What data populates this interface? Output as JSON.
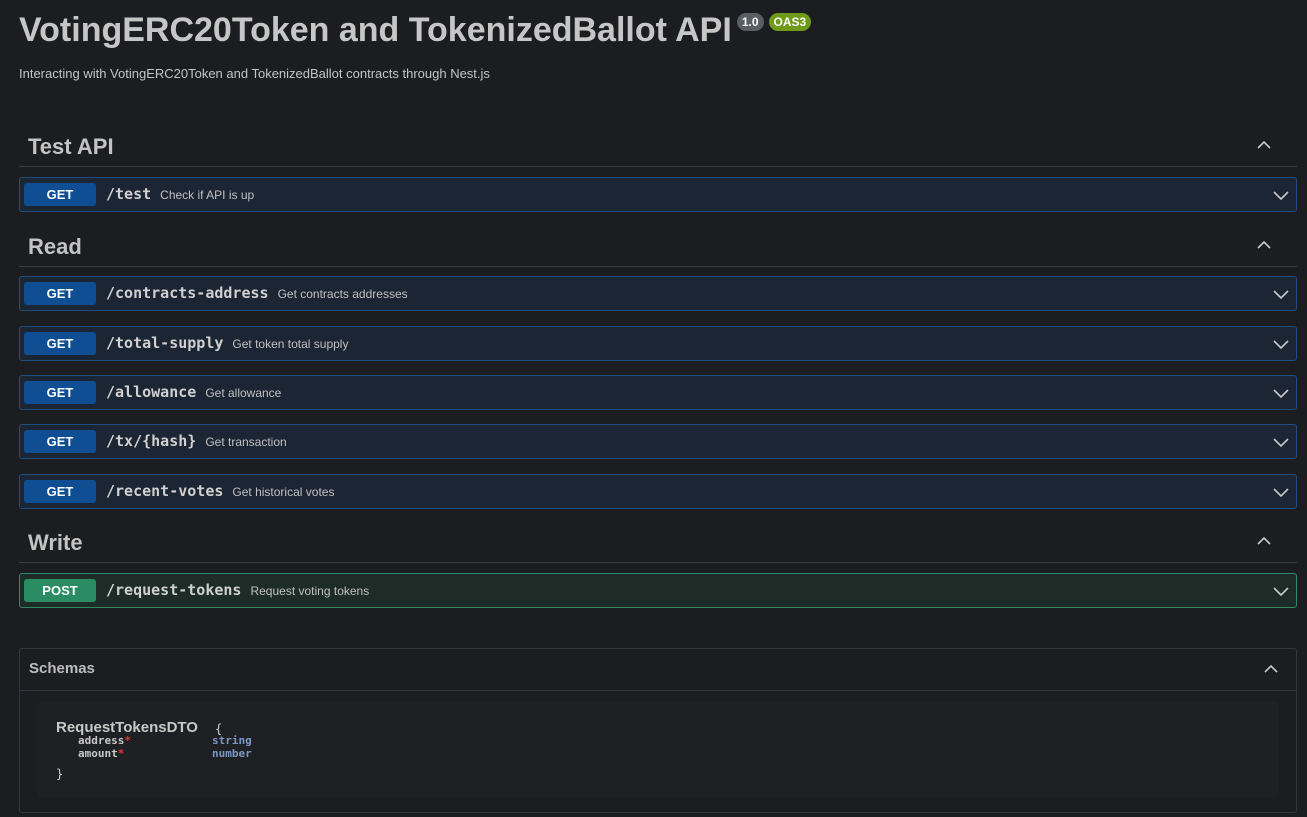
{
  "info": {
    "title": "VotingERC20Token and TokenizedBallot API",
    "version": "1.0",
    "oas": "OAS3",
    "description": "Interacting with VotingERC20Token and TokenizedBallot contracts through Nest.js"
  },
  "sections": [
    {
      "name": "Test API",
      "operations": [
        {
          "method": "GET",
          "path": "/test",
          "summary": "Check if API is up"
        }
      ]
    },
    {
      "name": "Read",
      "operations": [
        {
          "method": "GET",
          "path": "/contracts-address",
          "summary": "Get contracts addresses"
        },
        {
          "method": "GET",
          "path": "/total-supply",
          "summary": "Get token total supply"
        },
        {
          "method": "GET",
          "path": "/allowance",
          "summary": "Get allowance"
        },
        {
          "method": "GET",
          "path": "/tx/{hash}",
          "summary": "Get transaction"
        },
        {
          "method": "GET",
          "path": "/recent-votes",
          "summary": "Get historical votes"
        }
      ]
    },
    {
      "name": "Write",
      "operations": [
        {
          "method": "POST",
          "path": "/request-tokens",
          "summary": "Request voting tokens"
        }
      ]
    }
  ],
  "schemas": {
    "title": "Schemas",
    "model": {
      "name": "RequestTokensDTO",
      "open": "{",
      "close": "}",
      "properties": [
        {
          "name": "address",
          "required": "*",
          "type": "string"
        },
        {
          "name": "amount",
          "required": "*",
          "type": "number"
        }
      ]
    }
  },
  "icons": {
    "section_toggle": "chevron-up-icon",
    "operation_toggle": "chevron-down-icon"
  },
  "colors": {
    "background": "#1c1d20",
    "get_method": "#0f4e93",
    "post_method": "#2a8c63",
    "version_badge": "#585e64",
    "oas_badge": "#6e9a18",
    "required_star": "#e2393b",
    "type_text": "#7a98c2"
  }
}
